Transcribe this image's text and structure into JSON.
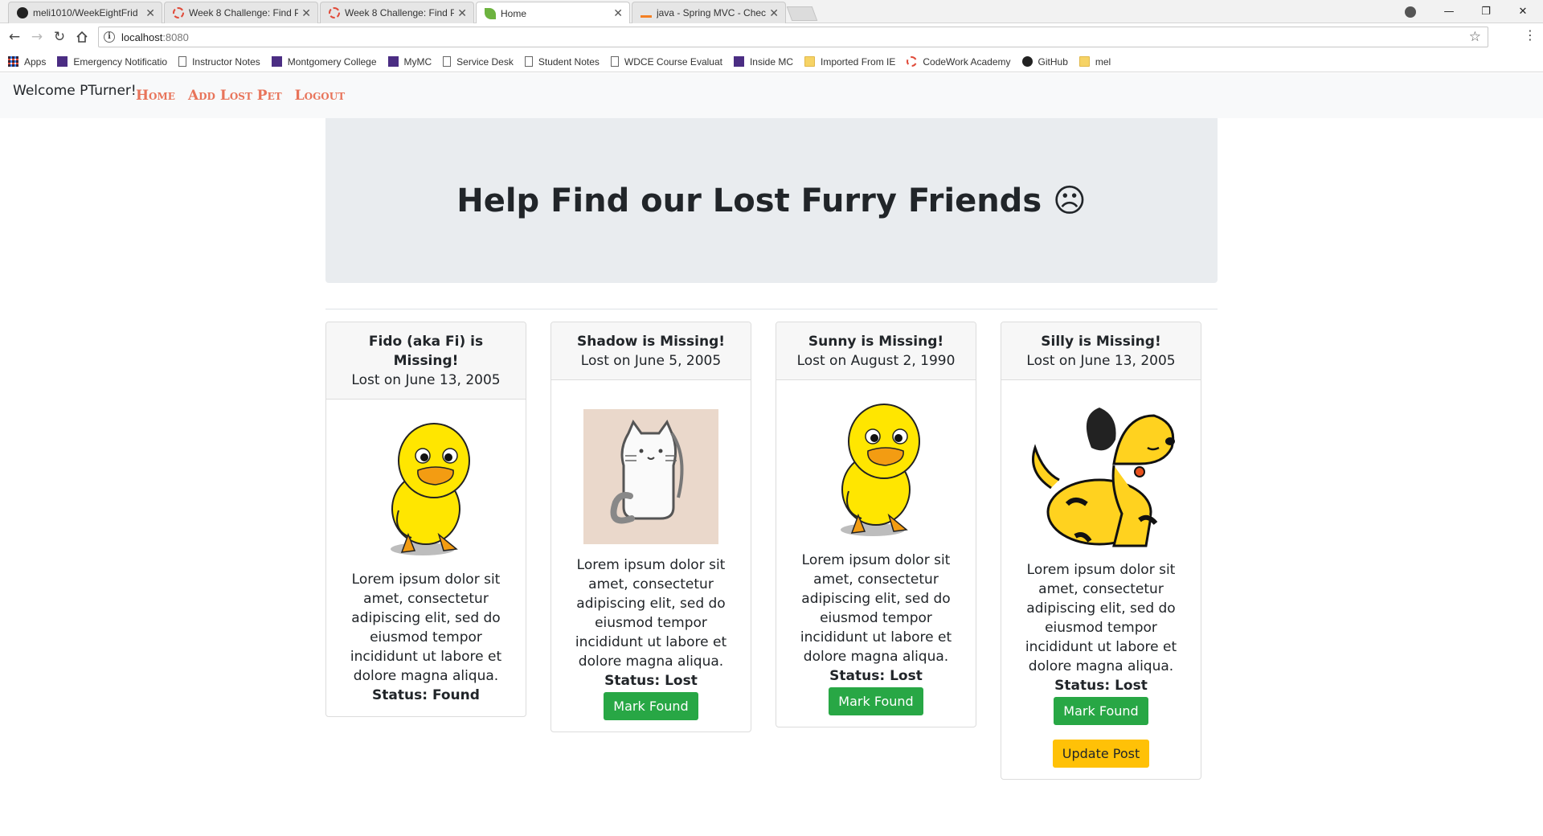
{
  "browser": {
    "tabs": [
      {
        "title": "meli1010/WeekEightFrid",
        "favicon": "github-icon"
      },
      {
        "title": "Week 8 Challenge: Find P",
        "favicon": "codework-icon"
      },
      {
        "title": "Week 8 Challenge: Find P",
        "favicon": "codework-icon"
      },
      {
        "title": "Home",
        "favicon": "spring-leaf-icon"
      },
      {
        "title": "java - Spring MVC - Chec",
        "favicon": "stackoverflow-icon"
      }
    ],
    "active_tab": 3,
    "url_host": "localhost",
    "url_port": ":8080",
    "bookmarks": [
      {
        "label": "Apps",
        "icon": "apps-grid-icon"
      },
      {
        "label": "Emergency Notificatio",
        "icon": "mc-icon"
      },
      {
        "label": "Instructor Notes",
        "icon": "page-icon"
      },
      {
        "label": "Montgomery College",
        "icon": "mc-icon"
      },
      {
        "label": "MyMC",
        "icon": "mc-icon"
      },
      {
        "label": "Service Desk",
        "icon": "page-icon"
      },
      {
        "label": "Student Notes",
        "icon": "page-icon"
      },
      {
        "label": "WDCE Course Evaluat",
        "icon": "page-icon"
      },
      {
        "label": "Inside MC",
        "icon": "mc-icon"
      },
      {
        "label": "Imported From IE",
        "icon": "folder-icon"
      },
      {
        "label": "CodeWork Academy",
        "icon": "codework-icon"
      },
      {
        "label": "GitHub",
        "icon": "github-icon"
      },
      {
        "label": "mel",
        "icon": "folder-icon"
      }
    ]
  },
  "navbar": {
    "welcome": "Welcome PTurner!",
    "links": [
      "Home",
      "Add Lost Pet",
      "Logout"
    ],
    "link_color": "#e8745a"
  },
  "hero": {
    "title": "Help Find our Lost Furry Friends ☹"
  },
  "pets": [
    {
      "title": "Fido (aka Fi) is Missing!",
      "date": "Lost on June 13, 2005",
      "image": "duck",
      "description": "Lorem ipsum dolor sit amet, consectetur adipiscing elit, sed do eiusmod tempor incididunt ut labore et dolore magna aliqua.",
      "status": "Status: Found"
    },
    {
      "title": "Shadow is Missing!",
      "date": "Lost on June 5, 2005",
      "image": "cat",
      "description": "Lorem ipsum dolor sit amet, consectetur adipiscing elit, sed do eiusmod tempor incididunt ut labore et dolore magna aliqua.",
      "status": "Status: Lost",
      "mark_found": "Mark Found"
    },
    {
      "title": "Sunny is Missing!",
      "date": "Lost on August 2, 1990",
      "image": "duck",
      "description": "Lorem ipsum dolor sit amet, consectetur adipiscing elit, sed do eiusmod tempor incididunt ut labore et dolore magna aliqua.",
      "status": "Status: Lost",
      "mark_found": "Mark Found"
    },
    {
      "title": "Silly is Missing!",
      "date": "Lost on June 13, 2005",
      "image": "dog",
      "description": "Lorem ipsum dolor sit amet, consectetur adipiscing elit, sed do eiusmod tempor incididunt ut labore et dolore magna aliqua.",
      "status": "Status: Lost",
      "mark_found": "Mark Found",
      "update": "Update Post"
    }
  ]
}
